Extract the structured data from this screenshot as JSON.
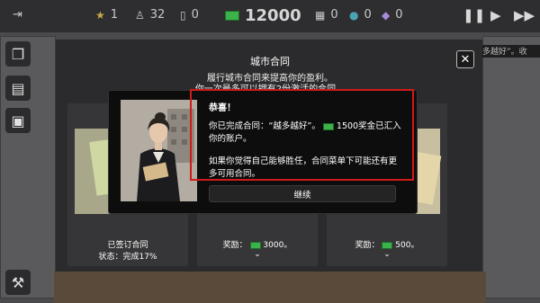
{
  "topbar": {
    "stars": "1",
    "population": "32",
    "workers": "0",
    "money": "12000",
    "resource_a": "0",
    "resource_b": "0",
    "resource_c": "0"
  },
  "panel": {
    "title": "城市合同",
    "subtitle_line1": "履行城市合同来提高你的盈利。",
    "subtitle_line2": "你一次最多可以拥有2份激活的合同。",
    "close_label": "✕",
    "cards": [
      {
        "line1": "已签订合同",
        "line2": "状态：完成17%"
      },
      {
        "line1": "奖励：",
        "amount": "3000。"
      },
      {
        "line1": "奖励：",
        "amount": "500。"
      }
    ],
    "right_edge_snippet": "多越好”。收"
  },
  "dialog": {
    "title": "恭喜！",
    "text1_a": "你已完成合同：“越多越好”。",
    "text1_b": "1500奖金已汇入你的账户。",
    "text2": "如果你觉得自己能够胜任，合同菜单下可能还有更多可用合同。",
    "continue_label": "继续"
  },
  "colors": {
    "highlight_box": "#d11a1a",
    "cash_green": "#3bb34a"
  }
}
